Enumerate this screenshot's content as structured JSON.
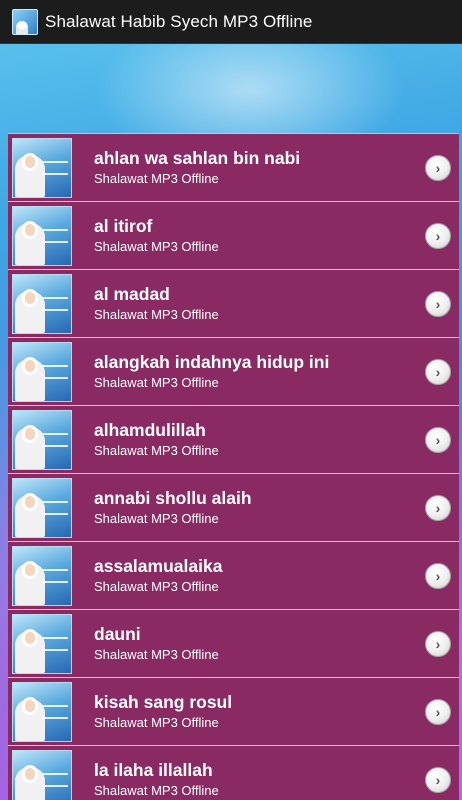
{
  "app": {
    "title": "Shalawat Habib Syech MP3 Offline"
  },
  "list": {
    "items": [
      {
        "title": "ahlan wa sahlan bin nabi",
        "subtitle": "Shalawat MP3 Offline"
      },
      {
        "title": "al itirof",
        "subtitle": "Shalawat MP3 Offline"
      },
      {
        "title": "al madad",
        "subtitle": "Shalawat MP3 Offline"
      },
      {
        "title": "alangkah indahnya hidup ini",
        "subtitle": "Shalawat MP3 Offline"
      },
      {
        "title": "alhamdulillah",
        "subtitle": "Shalawat MP3 Offline"
      },
      {
        "title": "annabi shollu alaih",
        "subtitle": "Shalawat MP3 Offline"
      },
      {
        "title": "assalamualaika",
        "subtitle": "Shalawat MP3 Offline"
      },
      {
        "title": "dauni",
        "subtitle": "Shalawat MP3 Offline"
      },
      {
        "title": "kisah sang rosul",
        "subtitle": "Shalawat MP3 Offline"
      },
      {
        "title": "la ilaha illallah",
        "subtitle": "Shalawat MP3 Offline"
      }
    ],
    "arrow_icon": "chevron-right-icon"
  },
  "colors": {
    "action_bar": "#1c1c1c",
    "row_background": "#8a2a63",
    "row_divider": "#c5c5d8",
    "text": "#ffffff"
  }
}
